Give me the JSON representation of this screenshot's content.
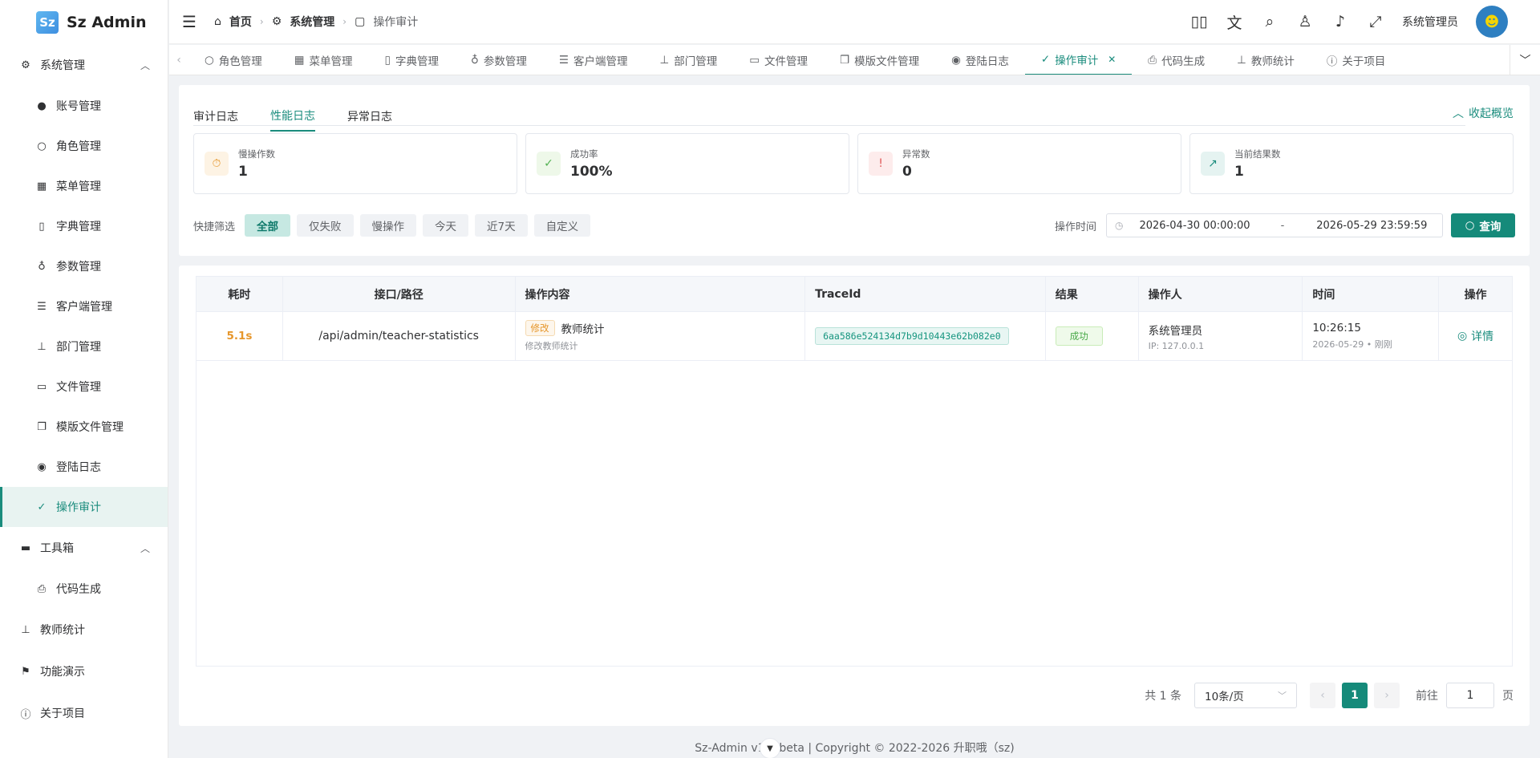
{
  "brand": {
    "logo_letter": "Sz",
    "name": "Sz Admin"
  },
  "sidebar": {
    "groups": [
      {
        "label": "系统管理",
        "expanded": true,
        "items": [
          {
            "label": "账号管理",
            "icon": "user-icon"
          },
          {
            "label": "角色管理",
            "icon": "user-outline-icon"
          },
          {
            "label": "菜单管理",
            "icon": "grid-icon"
          },
          {
            "label": "字典管理",
            "icon": "book-icon"
          },
          {
            "label": "参数管理",
            "icon": "flask-icon"
          },
          {
            "label": "客户端管理",
            "icon": "sliders-icon"
          },
          {
            "label": "部门管理",
            "icon": "org-icon"
          },
          {
            "label": "文件管理",
            "icon": "briefcase-icon"
          },
          {
            "label": "模版文件管理",
            "icon": "files-icon"
          },
          {
            "label": "登陆日志",
            "icon": "location-icon"
          },
          {
            "label": "操作审计",
            "icon": "doc-check-icon",
            "active": true
          }
        ]
      },
      {
        "label": "工具箱",
        "expanded": true,
        "items": [
          {
            "label": "代码生成",
            "icon": "printer-icon"
          }
        ]
      }
    ],
    "singles": [
      {
        "label": "教师统计",
        "icon": "org-icon"
      },
      {
        "label": "功能演示",
        "icon": "flag-icon"
      },
      {
        "label": "关于项目",
        "icon": "info-icon"
      }
    ]
  },
  "header": {
    "breadcrumb": [
      "首页",
      "系统管理",
      "操作审计"
    ],
    "username": "系统管理员"
  },
  "tabs": [
    {
      "label": "角色管理"
    },
    {
      "label": "菜单管理"
    },
    {
      "label": "字典管理"
    },
    {
      "label": "参数管理"
    },
    {
      "label": "客户端管理"
    },
    {
      "label": "部门管理"
    },
    {
      "label": "文件管理"
    },
    {
      "label": "模版文件管理"
    },
    {
      "label": "登陆日志"
    },
    {
      "label": "操作审计",
      "active": true
    },
    {
      "label": "代码生成"
    },
    {
      "label": "教师统计"
    },
    {
      "label": "关于项目"
    }
  ],
  "subtabs": [
    {
      "label": "审计日志"
    },
    {
      "label": "性能日志",
      "active": true
    },
    {
      "label": "异常日志"
    }
  ],
  "collapse_label": "收起概览",
  "stats": [
    {
      "label": "慢操作数",
      "value": "1",
      "icon": "stopwatch-icon",
      "color": "#e6962b",
      "bg": "#fdf3e4"
    },
    {
      "label": "成功率",
      "value": "100%",
      "icon": "check-circle-icon",
      "color": "#52b152",
      "bg": "#eef8e9"
    },
    {
      "label": "异常数",
      "value": "0",
      "icon": "alert-circle-icon",
      "color": "#e05a5a",
      "bg": "#fdecec"
    },
    {
      "label": "当前结果数",
      "value": "1",
      "icon": "trend-icon",
      "color": "#1a8c7d",
      "bg": "#e5f3f1"
    }
  ],
  "filters": {
    "quick_label": "快捷筛选",
    "chips": [
      {
        "label": "全部",
        "active": true
      },
      {
        "label": "仅失败"
      },
      {
        "label": "慢操作"
      },
      {
        "label": "今天"
      },
      {
        "label": "近7天"
      },
      {
        "label": "自定义"
      }
    ],
    "time_label": "操作时间",
    "start": "2026-04-30 00:00:00",
    "separator": "-",
    "end": "2026-05-29 23:59:59",
    "search_label": "查询"
  },
  "table": {
    "columns": [
      "耗时",
      "接口/路径",
      "操作内容",
      "TraceId",
      "结果",
      "操作人",
      "时间",
      "操作"
    ],
    "rows": [
      {
        "duration": "5.1s",
        "path": "/api/admin/teacher-statistics",
        "op_tag": "修改",
        "op_title": "教师统计",
        "op_desc": "修改教师统计",
        "trace_id": "6aa586e524134d7b9d10443e62b082e0",
        "result": "成功",
        "operator": "系统管理员",
        "ip": "IP: 127.0.0.1",
        "time": "10:26:15",
        "date": "2026-05-29 • 刚刚",
        "action": "详情"
      }
    ]
  },
  "pagination": {
    "total": "共 1 条",
    "page_size": "10条/页",
    "current": "1",
    "goto_label": "前往",
    "goto_value": "1",
    "page_suffix": "页"
  },
  "footer": {
    "text": "Sz-Admin v1    beta | Copyright © 2022-2026 升职哦（sz)"
  }
}
